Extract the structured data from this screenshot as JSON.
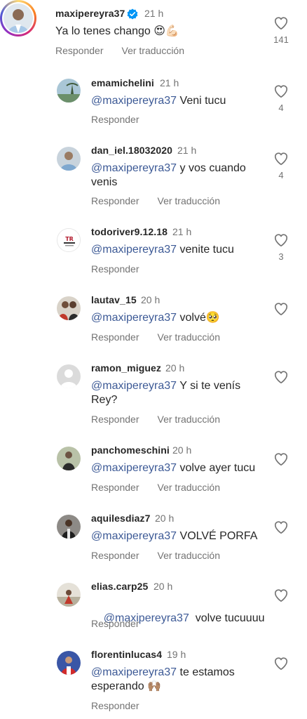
{
  "main_comment": {
    "username": "maxipereyra37",
    "time": "21 h",
    "text": "Ya lo tenes chango 😍💪🏻",
    "reply_label": "Responder",
    "translate_label": "Ver traducción",
    "likes": "141"
  },
  "replies": [
    {
      "username": "emamichelini",
      "time": "21 h",
      "mention": "@maxipereyra37",
      "text": " Veni tucu",
      "text2": "",
      "reply_label": "Responder",
      "translate_label": "",
      "likes": "4"
    },
    {
      "username": "dan_iel.18032020",
      "time": "21 h",
      "mention": "@maxipereyra37",
      "text": " y vos cuando",
      "text2": "venis",
      "reply_label": "Responder",
      "translate_label": "Ver traducción",
      "likes": "4"
    },
    {
      "username": "todoriver9.12.18",
      "time": "21 h",
      "mention": "@maxipereyra37",
      "text": " venite tucu",
      "text2": "",
      "reply_label": "Responder",
      "translate_label": "",
      "likes": "3"
    },
    {
      "username": "lautav_15",
      "time": "20 h",
      "mention": "@maxipereyra37",
      "text": " volvé🥺",
      "text2": "",
      "reply_label": "Responder",
      "translate_label": "Ver traducción",
      "likes": ""
    },
    {
      "username": "ramon_miguez",
      "time": "20 h",
      "mention": "@maxipereyra37",
      "text": " Y si te venís",
      "text2": "Rey?",
      "reply_label": "Responder",
      "translate_label": "Ver traducción",
      "likes": ""
    },
    {
      "username": "panchomeschini",
      "time": "20 h",
      "mention": "@maxipereyra37",
      "text": " volve ayer tucu",
      "text2": "",
      "reply_label": "Responder",
      "translate_label": "Ver traducción",
      "likes": ""
    },
    {
      "username": "aquilesdiaz7",
      "time": "20 h",
      "mention": "@maxipereyra37",
      "text": " VOLVÉ PORFA",
      "text2": "",
      "reply_label": "Responder",
      "translate_label": "Ver traducción",
      "likes": ""
    },
    {
      "username": "elias.carp25",
      "time": "20 h",
      "mention": "@maxipereyra37",
      "text": "  volve tucuuuu",
      "text2": "",
      "reply_label": "Responder",
      "translate_label": "",
      "likes": ""
    },
    {
      "username": "florentinlucas4",
      "time": "19 h",
      "mention": "@maxipereyra37",
      "text": " te estamos",
      "text2": "esperando 🙌🏽",
      "reply_label": "Responder",
      "translate_label": "",
      "likes": ""
    }
  ],
  "icons": {
    "heart": "heart-outline-icon",
    "verified": "verified-badge-icon"
  },
  "colors": {
    "mention": "#3d5a96",
    "verified": "#0095f6",
    "secondary_text": "#737373"
  }
}
